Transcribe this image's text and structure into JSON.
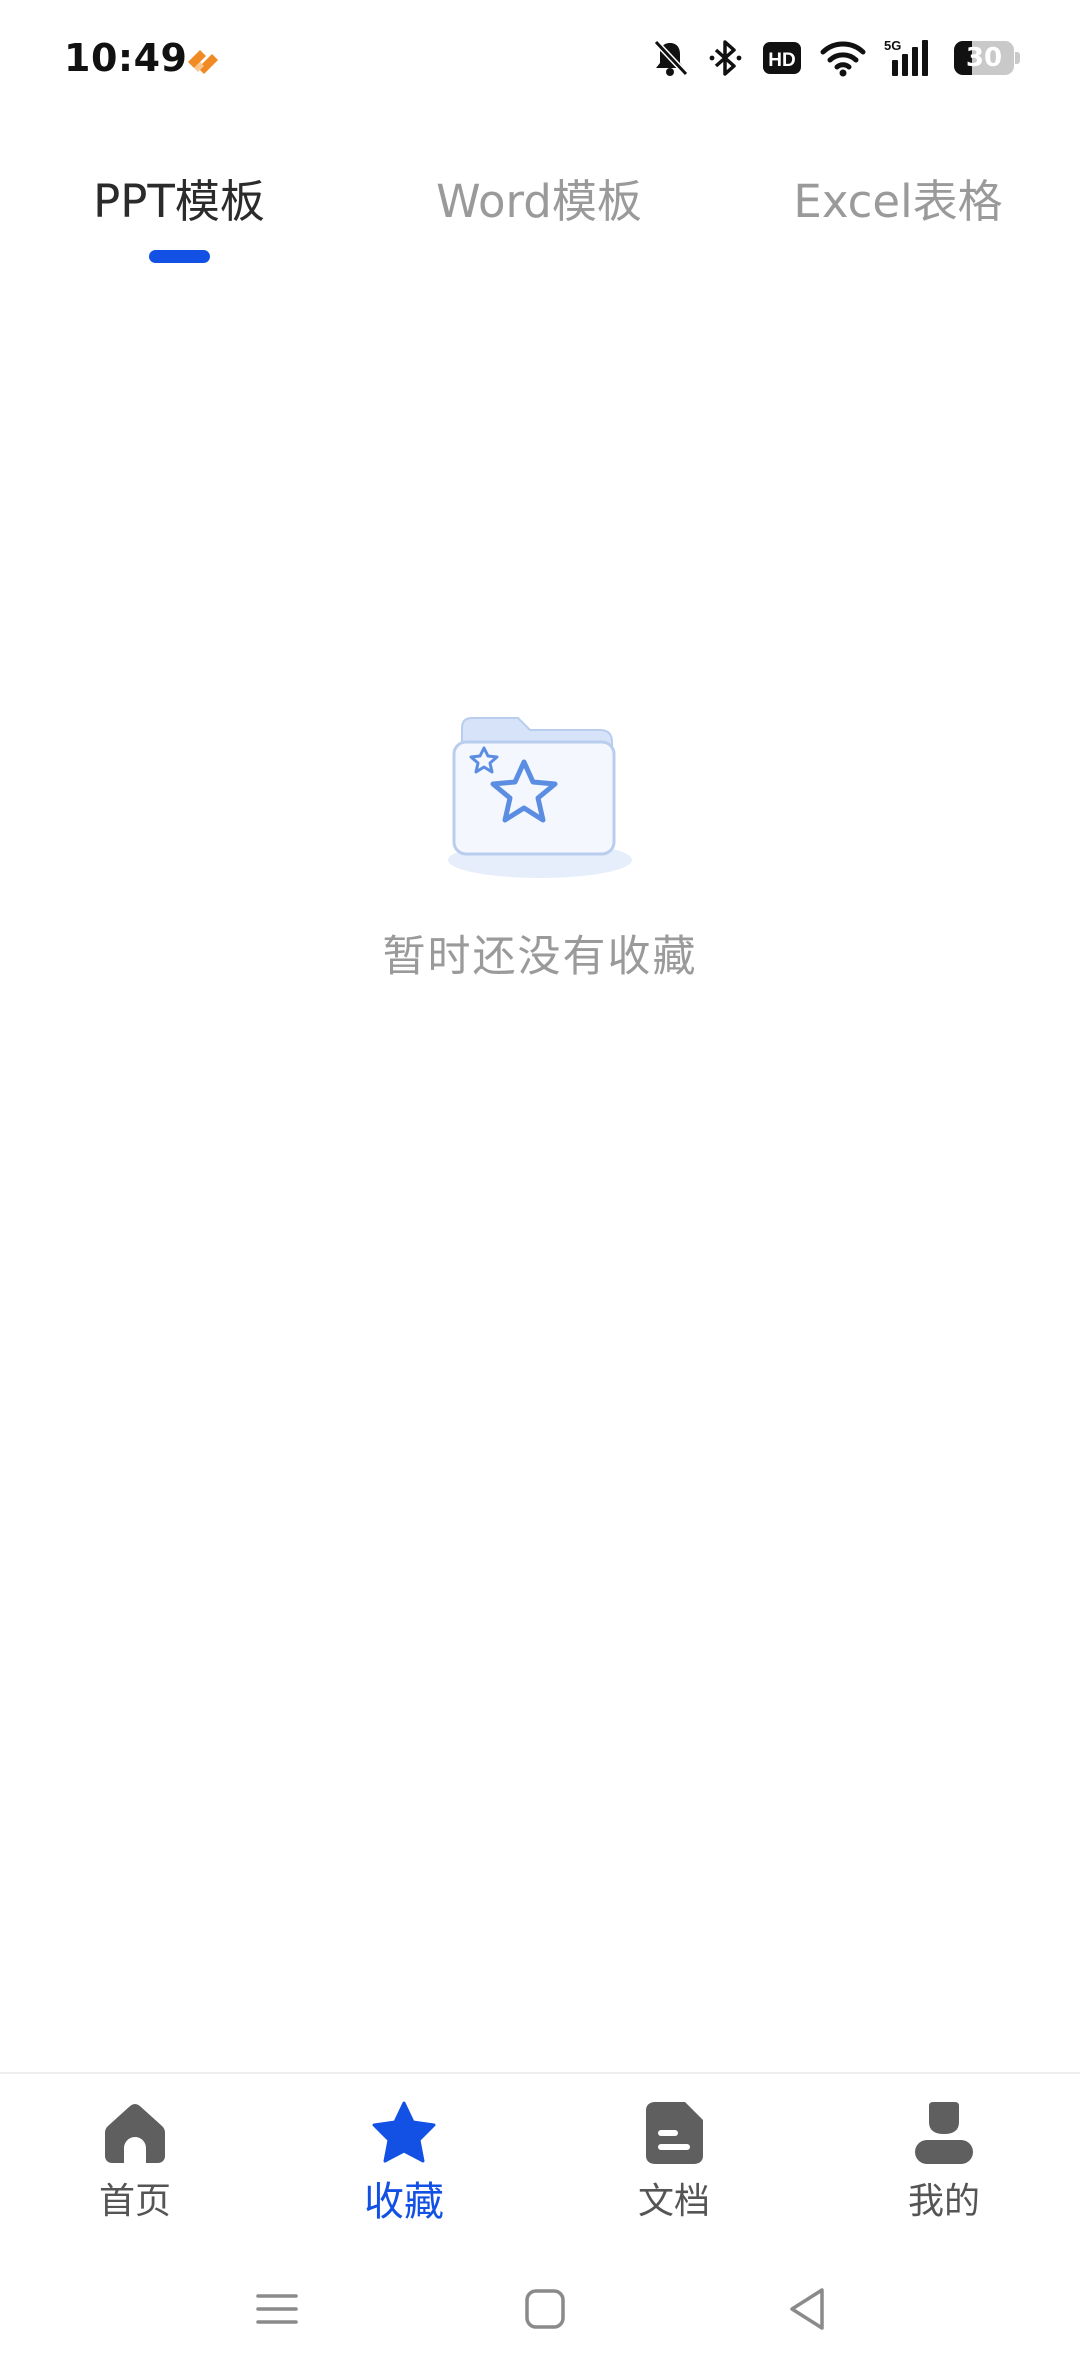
{
  "status_bar": {
    "time": "10:49",
    "battery": "30",
    "icons": [
      "app-notification-icon",
      "mute-bell-icon",
      "bluetooth-icon",
      "hd-icon",
      "wifi-icon",
      "5g-signal-icon",
      "battery-icon"
    ]
  },
  "tabs": [
    {
      "label": "PPT模板",
      "active": true
    },
    {
      "label": "Word模板",
      "active": false
    },
    {
      "label": "Excel表格",
      "active": false
    }
  ],
  "empty_state": {
    "icon": "folder-star-icon",
    "message": "暂时还没有收藏"
  },
  "bottom_nav": [
    {
      "label": "首页",
      "icon": "home-icon",
      "active": false
    },
    {
      "label": "收藏",
      "icon": "star-icon",
      "active": true
    },
    {
      "label": "文档",
      "icon": "document-icon",
      "active": false
    },
    {
      "label": "我的",
      "icon": "profile-icon",
      "active": false
    }
  ],
  "system_nav": [
    "menu-icon",
    "home-square-icon",
    "back-triangle-icon"
  ],
  "colors": {
    "accent": "#1351e5",
    "active_text": "#2b2b2b",
    "inactive_text": "#9a9a9a",
    "nav_icon": "#5f5f5f",
    "illustration_blue": "#5b8de3",
    "illustration_light": "#e6eefb"
  }
}
